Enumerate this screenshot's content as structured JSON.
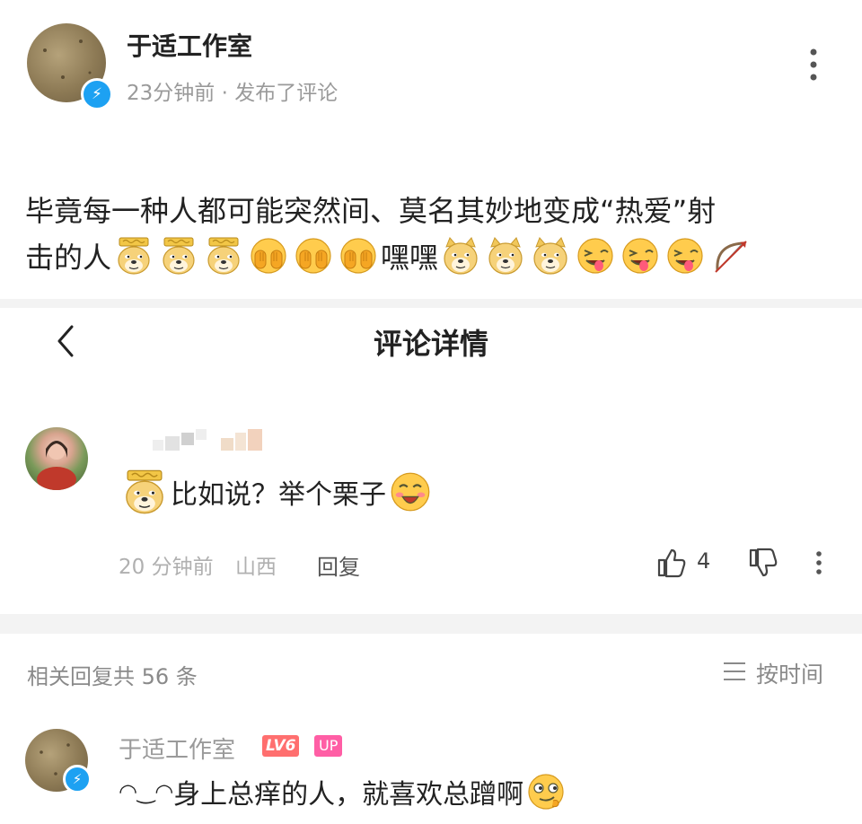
{
  "post": {
    "author": "于适工作室",
    "meta": "23分钟前 · 发布了评论",
    "text_line1": "毕竟每一种人都可能突然间、莫名其妙地变成“热爱”射",
    "text_line2_prefix": "击的人",
    "text_line2_mid": "嘿嘿"
  },
  "nav": {
    "title": "评论详情"
  },
  "comment": {
    "text": "比如说？举个栗子",
    "time": "20 分钟前",
    "location": "山西",
    "reply_label": "回复",
    "like_count": "4"
  },
  "replies_bar": {
    "count_text": "相关回复共 56 条",
    "sort_label": "按时间"
  },
  "reply": {
    "author": "于适工作室",
    "level_badge": "LV6",
    "up_badge": "UP",
    "text_prefix": "◠‿◠",
    "text": "身上总痒的人，就喜欢总蹭啊"
  },
  "colors": {
    "verified": "#1da1f2",
    "level_badge": "#ff6f6f",
    "up_badge": "#ff5ea5",
    "secondary_text": "#9a9a9a"
  }
}
